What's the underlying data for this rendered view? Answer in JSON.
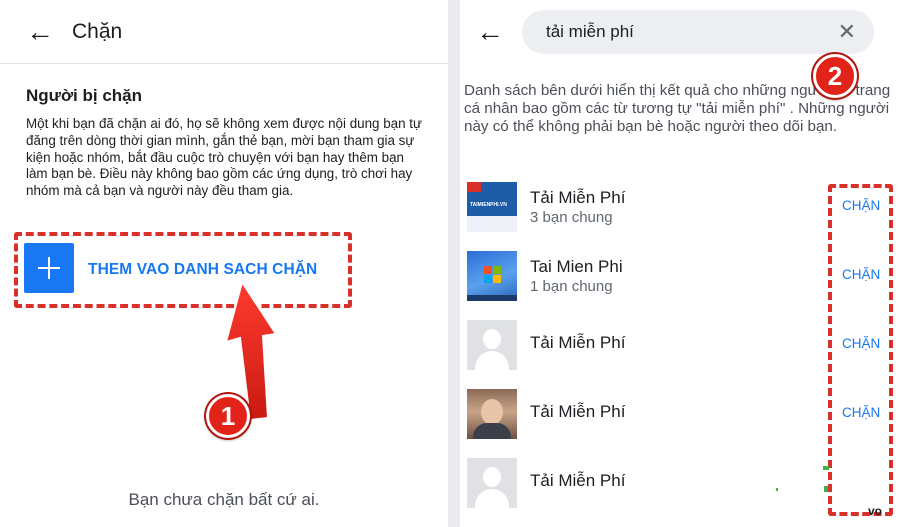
{
  "left_screen": {
    "header_title": "Chặn",
    "section_title": "Người bị chặn",
    "description": "Một khi bạn đã chặn ai đó, họ sẽ không xem được nội dung bạn tự đăng trên dòng thời gian mình, gắn thẻ bạn, mời bạn tham gia sự kiện hoặc nhóm, bắt đầu cuộc trò chuyện với bạn hay thêm bạn làm bạn bè. Điều này không bao gồm các ứng dụng, trò chơi hay nhóm mà cả bạn và người này đều tham gia.",
    "add_button_label": "THEM VAO DANH SACH CHẶN",
    "empty_message": "Bạn chưa chặn bất cứ ai.",
    "marker": "1"
  },
  "right_screen": {
    "search_value": "tải miễn phí",
    "description": "Danh sách bên dưới hiển thị kết quả cho những người có trang cá nhân bao gồm các từ tương tự \"tải miễn phí\" . Những người này có thể không phải bạn bè hoặc người theo dõi bạn.",
    "marker": "2",
    "results": [
      {
        "name": "Tải Miễn Phí",
        "mutual": "3 bạn chung",
        "action": "CHẶN",
        "avatar": "brand-logo"
      },
      {
        "name": "Tai Mien Phi",
        "mutual": "1 bạn chung",
        "action": "CHẶN",
        "avatar": "windows-logo"
      },
      {
        "name": "Tải Miễn Phí",
        "mutual": "",
        "action": "CHẶN",
        "avatar": "default-profile"
      },
      {
        "name": "Tải Miễn Phí",
        "mutual": "",
        "action": "CHẶN",
        "avatar": "child-photo"
      },
      {
        "name": "Tải Miễn Phí",
        "mutual": "",
        "action": "",
        "avatar": "default-profile"
      }
    ],
    "cut_text": "vo"
  },
  "colors": {
    "accent_blue": "#1877f2",
    "annotation_red": "#d9302a",
    "divider": "#e9ebee"
  }
}
